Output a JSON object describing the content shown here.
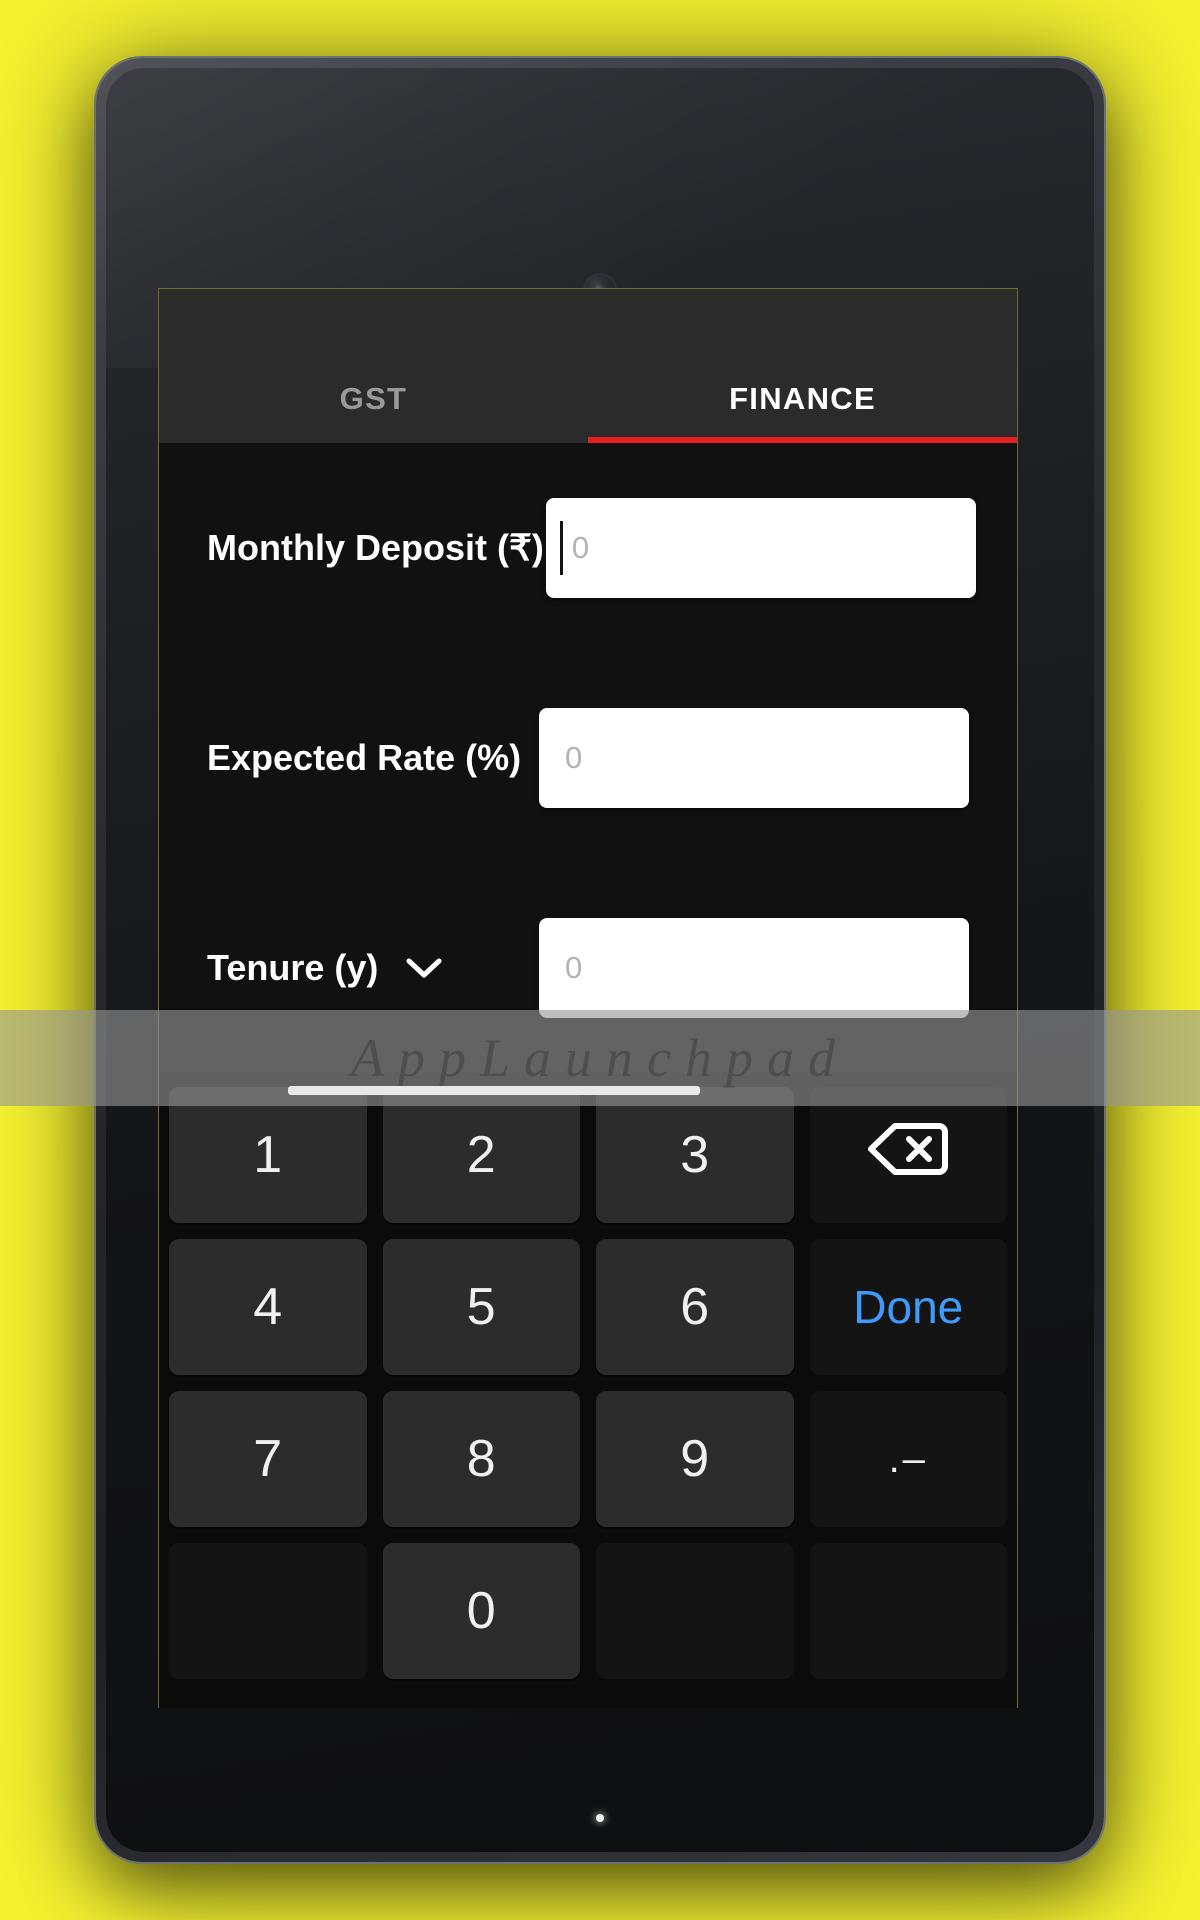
{
  "app": {
    "background_color": "#F2EF28",
    "accent_color": "#E61F1F",
    "done_color": "#3E9BFB"
  },
  "tabs": [
    {
      "label": "GST",
      "active": false
    },
    {
      "label": "FINANCE",
      "active": true
    }
  ],
  "form": {
    "fields": [
      {
        "label": "Monthly Deposit (₹)",
        "value": "",
        "placeholder": "0",
        "has_caret": true,
        "has_dropdown": false
      },
      {
        "label": "Expected Rate (%)",
        "value": "",
        "placeholder": "0",
        "has_caret": false,
        "has_dropdown": false
      },
      {
        "label": "Tenure (y)",
        "value": "",
        "placeholder": "0",
        "has_caret": false,
        "has_dropdown": true,
        "dropdown_icon": "chevron-down-icon"
      }
    ]
  },
  "keyboard": {
    "rows": [
      [
        {
          "label": "1",
          "name": "key-1",
          "kind": "digit"
        },
        {
          "label": "2",
          "name": "key-2",
          "kind": "digit"
        },
        {
          "label": "3",
          "name": "key-3",
          "kind": "digit"
        },
        {
          "label": "",
          "name": "key-backspace",
          "kind": "backspace-icon"
        }
      ],
      [
        {
          "label": "4",
          "name": "key-4",
          "kind": "digit"
        },
        {
          "label": "5",
          "name": "key-5",
          "kind": "digit"
        },
        {
          "label": "6",
          "name": "key-6",
          "kind": "digit"
        },
        {
          "label": "Done",
          "name": "key-done",
          "kind": "done"
        }
      ],
      [
        {
          "label": "7",
          "name": "key-7",
          "kind": "digit"
        },
        {
          "label": "8",
          "name": "key-8",
          "kind": "digit"
        },
        {
          "label": "9",
          "name": "key-9",
          "kind": "digit"
        },
        {
          "label": ".–",
          "name": "key-dot-dash",
          "kind": "dotdash"
        }
      ],
      [
        {
          "label": "",
          "name": "key-blank-left",
          "kind": "blank"
        },
        {
          "label": "0",
          "name": "key-0",
          "kind": "digit"
        },
        {
          "label": "",
          "name": "key-blank-right",
          "kind": "blank"
        },
        {
          "label": "",
          "name": "key-blank-far-right",
          "kind": "blank"
        }
      ]
    ]
  },
  "watermark": {
    "text": "AppLaunchpad"
  }
}
